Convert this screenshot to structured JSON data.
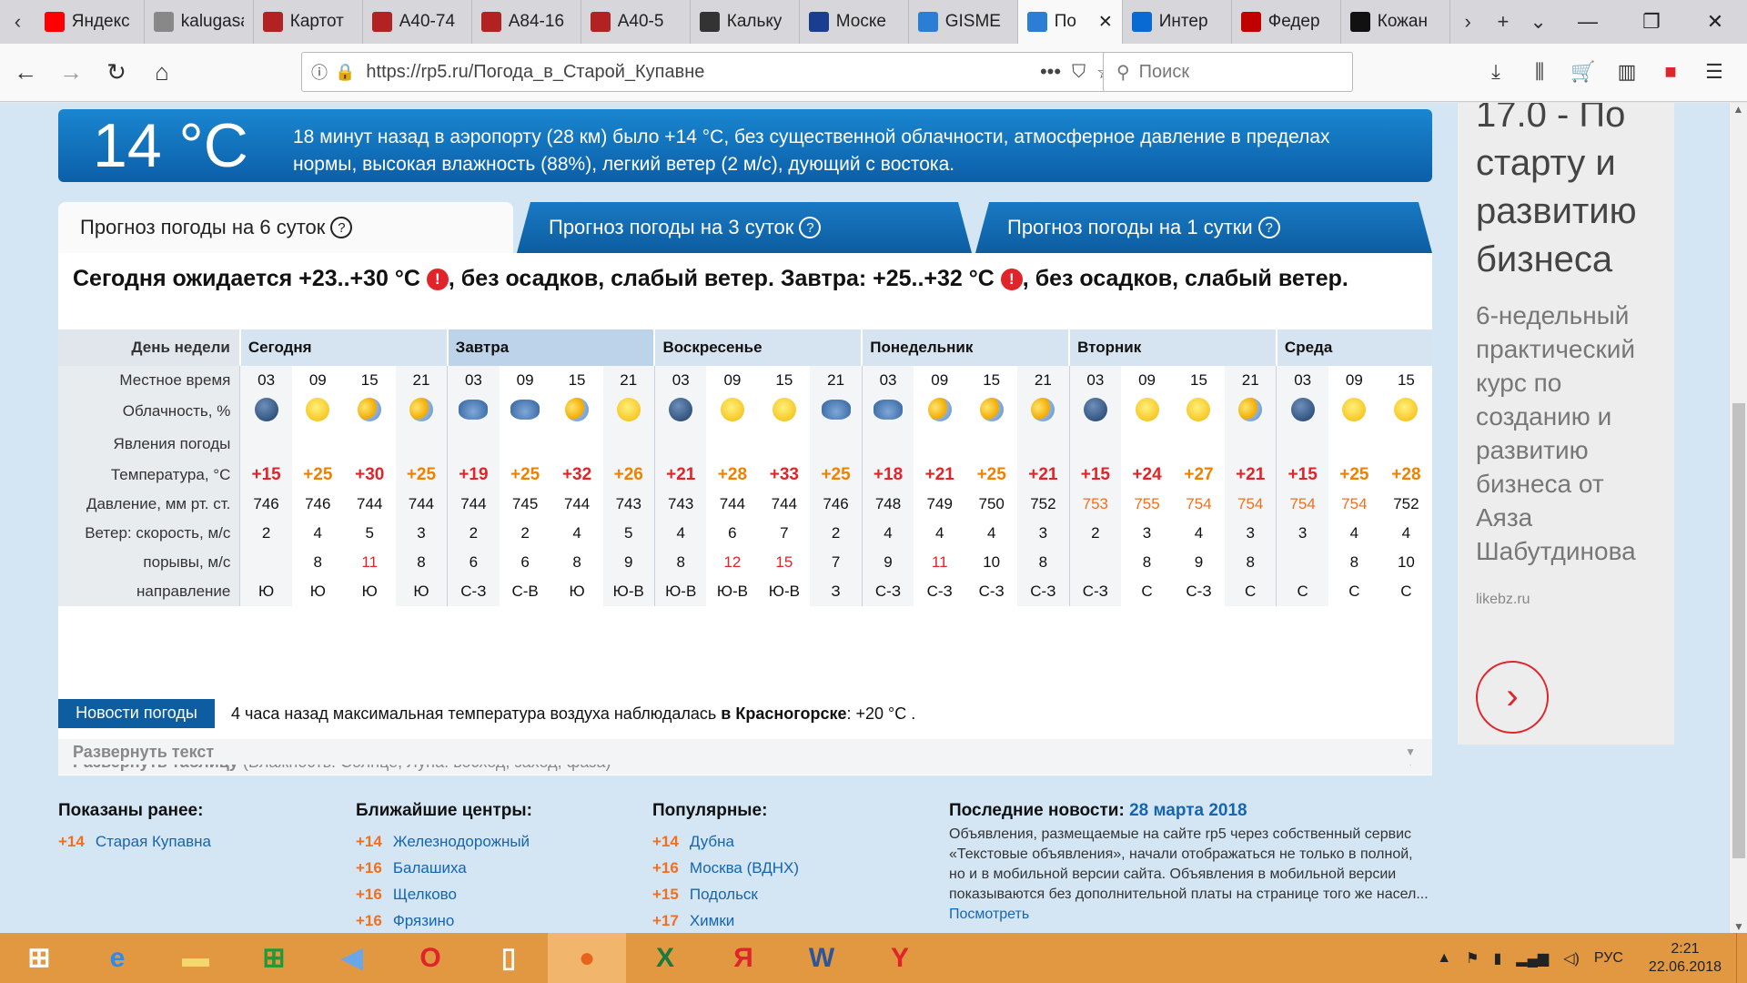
{
  "browser": {
    "tabs": [
      {
        "label": "Яндекс",
        "icon": "yandex-icon",
        "color": "#ff0000"
      },
      {
        "label": "kalugasad",
        "icon": "page-icon",
        "color": "#888888"
      },
      {
        "label": "Картот",
        "icon": "emblem-icon",
        "color": "#b22222"
      },
      {
        "label": "A40-74",
        "icon": "emblem-icon",
        "color": "#b22222"
      },
      {
        "label": "A84-16",
        "icon": "emblem-icon",
        "color": "#b22222"
      },
      {
        "label": "A40-5",
        "icon": "emblem-icon",
        "color": "#b22222"
      },
      {
        "label": "Кальку",
        "icon": "calc-icon",
        "color": "#333333"
      },
      {
        "label": "Моске",
        "icon": "globe-icon",
        "color": "#1a3d8f"
      },
      {
        "label": "GISME",
        "icon": "drop-icon",
        "color": "#2a7fd4"
      },
      {
        "label": "По",
        "icon": "weather-icon",
        "color": "#2a7fd4",
        "active": true
      },
      {
        "label": "Интер",
        "icon": "circle-icon",
        "color": "#0a6ad4"
      },
      {
        "label": "Федер",
        "icon": "emblem-icon",
        "color": "#c00000"
      },
      {
        "label": "Кожан",
        "icon": "ms-icon",
        "color": "#111111"
      }
    ],
    "url": "https://rp5.ru/Погода_в_Старой_Купавне",
    "search_placeholder": "Поиск"
  },
  "current": {
    "temp": "14 °С",
    "desc": "18 минут назад в аэропорту (28 км) было +14 °C, без существенной облачности, атмосферное давление в пределах нормы, высокая влажность (88%), легкий ветер (2 м/с), дующий с востока."
  },
  "forecast_tabs": [
    "Прогноз погоды на 6 суток",
    "Прогноз погоды на 3 суток",
    "Прогноз погоды на 1 сутки"
  ],
  "summary": {
    "part1": "Сегодня ожидается +23..+30 °C",
    "part2": ", без осадков, слабый ветер. Завтра: +25..+32 °C",
    "part3": ", без осадков, слабый ветер."
  },
  "labels": {
    "day": "День недели",
    "time": "Местное время",
    "cloud": "Облачность, %",
    "phen": "Явления погоды",
    "temp": "Температура, °C",
    "pres": "Давление, мм рт. ст.",
    "wind": "Ветер: скорость, м/с",
    "gust": "порывы, м/с",
    "dir": "направление"
  },
  "days": [
    {
      "name": "Сегодня",
      "cols": 4
    },
    {
      "name": "Завтра",
      "cols": 4
    },
    {
      "name": "Воскресенье",
      "cols": 4
    },
    {
      "name": "Понедельник",
      "cols": 4
    },
    {
      "name": "Вторник",
      "cols": 4
    },
    {
      "name": "Среда",
      "cols": 3
    }
  ],
  "times": [
    "03",
    "09",
    "15",
    "21",
    "03",
    "09",
    "15",
    "21",
    "03",
    "09",
    "15",
    "21",
    "03",
    "09",
    "15",
    "21",
    "03",
    "09",
    "15",
    "21",
    "03",
    "09",
    "15"
  ],
  "clouds": [
    "moon",
    "sun",
    "psun",
    "psun",
    "cloud",
    "cloud",
    "psun",
    "sun",
    "moon",
    "sun",
    "sun",
    "cloud",
    "cloud",
    "psun",
    "psun",
    "psun",
    "moon",
    "sun",
    "sun",
    "psun",
    "moon",
    "sun",
    "sun"
  ],
  "temps": [
    "+15",
    "+25",
    "+30",
    "+25",
    "+19",
    "+25",
    "+32",
    "+26",
    "+21",
    "+28",
    "+33",
    "+25",
    "+18",
    "+21",
    "+25",
    "+21",
    "+15",
    "+24",
    "+27",
    "+21",
    "+15",
    "+25",
    "+28"
  ],
  "pressure": [
    "746",
    "746",
    "744",
    "744",
    "744",
    "745",
    "744",
    "743",
    "743",
    "744",
    "744",
    "746",
    "748",
    "749",
    "750",
    "752",
    "753",
    "755",
    "754",
    "754",
    "754",
    "754",
    "752"
  ],
  "wind": [
    "2",
    "4",
    "5",
    "3",
    "2",
    "2",
    "4",
    "5",
    "4",
    "6",
    "7",
    "2",
    "4",
    "4",
    "4",
    "3",
    "2",
    "3",
    "4",
    "3",
    "3",
    "4",
    "4"
  ],
  "gusts": [
    "",
    "8",
    "11",
    "8",
    "6",
    "6",
    "8",
    "9",
    "8",
    "12",
    "15",
    "7",
    "9",
    "11",
    "10",
    "8",
    "",
    "8",
    "9",
    "8",
    "",
    "8",
    "10"
  ],
  "dirs": [
    "Ю",
    "Ю",
    "Ю",
    "Ю",
    "С-З",
    "С-В",
    "Ю",
    "Ю-В",
    "Ю-В",
    "Ю-В",
    "Ю-В",
    "З",
    "С-З",
    "С-З",
    "С-З",
    "С-З",
    "С-З",
    "С",
    "С-З",
    "С",
    "С",
    "С",
    "С"
  ],
  "expand_table": "Развернуть таблицу",
  "expand_table_note": " (Влажность. Солнце, Луна: восход, заход, фаза)",
  "news": {
    "badge": "Новости погоды",
    "text1": "4 часа назад максимальная температура воздуха наблюдалась ",
    "text2": "в Красногорске",
    "text3": ": +20 °C .",
    "expand": "Развернуть текст"
  },
  "footer": {
    "prev": {
      "title": "Показаны ранее:",
      "items": [
        {
          "t": "+14",
          "n": "Старая Купавна"
        }
      ]
    },
    "near": {
      "title": "Ближайшие центры:",
      "items": [
        {
          "t": "+14",
          "n": "Железнодорожный"
        },
        {
          "t": "+16",
          "n": "Балашиха"
        },
        {
          "t": "+16",
          "n": "Щелково"
        },
        {
          "t": "+16",
          "n": "Фрязино"
        }
      ]
    },
    "pop": {
      "title": "Популярные:",
      "items": [
        {
          "t": "+14",
          "n": "Дубна"
        },
        {
          "t": "+16",
          "n": "Москва (ВДНХ)"
        },
        {
          "t": "+15",
          "n": "Подольск"
        },
        {
          "t": "+17",
          "n": "Химки"
        }
      ]
    },
    "latest": {
      "title": "Последние новости: ",
      "date": "28 марта 2018",
      "text": "Объявления, размещаемые на сайте rp5 через собственный сервис «Текстовые объявления», начали отображаться не только в полной, но и в мобильной версии сайта. Объявления в мобильной версии показываются без дополнительной платы на странице того же насел...",
      "more": "Посмотреть"
    }
  },
  "ad": {
    "headline": "17.0 - По старту и развитию бизнеса",
    "text": "6-недельный практический курс по созданию и развитию бизнеса от Аяза Шабутдинова",
    "source": "likebz.ru"
  },
  "taskbar": {
    "lang": "РУС",
    "time": "2:21",
    "date": "22.06.2018"
  }
}
